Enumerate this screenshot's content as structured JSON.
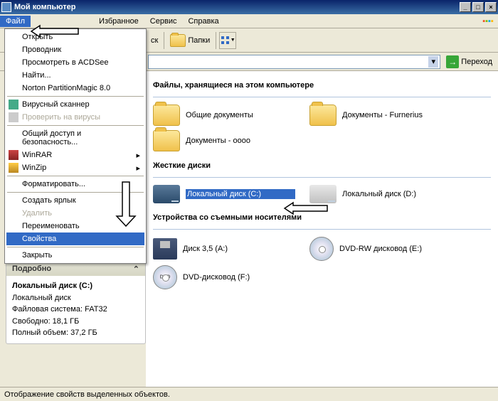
{
  "titlebar": {
    "title": "Мой компьютер"
  },
  "menubar": {
    "file": "Файл",
    "favorites": "Избранное",
    "tools": "Сервис",
    "help": "Справка"
  },
  "toolbar": {
    "search_fragment": "ск",
    "folders": "Папки"
  },
  "addrbar": {
    "go": "Переход"
  },
  "dropdown": {
    "open": "Открыть",
    "explorer": "Проводник",
    "acdsee": "Просмотреть в ACDSee",
    "find": "Найти...",
    "norton": "Norton PartitionMagic 8.0",
    "virus_scan": "Вирусный сканнер",
    "virus_check": "Проверить на вирусы",
    "sharing": "Общий доступ и безопасность...",
    "winrar": "WinRAR",
    "winzip": "WinZip",
    "format": "Форматировать...",
    "shortcut": "Создать ярлык",
    "delete": "Удалить",
    "rename": "Переименовать",
    "properties": "Свойства",
    "close": "Закрыть"
  },
  "details": {
    "header": "Подробно",
    "chevron": "⌃",
    "title": "Локальный диск (C:)",
    "type": "Локальный диск",
    "fs": "Файловая система: FAT32",
    "free": "Свободно: 18,1 ГБ",
    "total": "Полный объем: 37,2 ГБ"
  },
  "main": {
    "group_files": "Файлы, хранящиеся на этом компьютере",
    "shared_docs": "Общие документы",
    "docs_furnerius": "Документы - Furnerius",
    "docs_oooo": "Документы - oooo",
    "group_hdd": "Жесткие диски",
    "disk_c": "Локальный диск (C:)",
    "disk_d": "Локальный диск (D:)",
    "group_removable": "Устройства со съемными носителями",
    "floppy": "Диск 3,5 (A:)",
    "dvdrw": "DVD-RW дисковод (E:)",
    "dvd": "DVD-дисковод (F:)"
  },
  "statusbar": {
    "text": "Отображение свойств выделенных объектов."
  }
}
